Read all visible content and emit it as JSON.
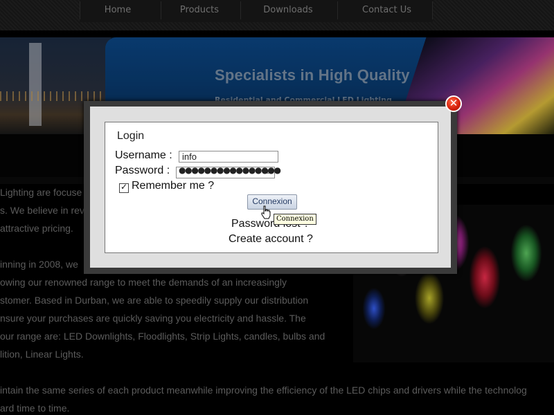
{
  "nav": {
    "items": [
      "Home",
      "Products",
      "Downloads",
      "Contact Us"
    ]
  },
  "banner": {
    "title": "Specialists in High Quality",
    "subtitle": "Residential and Commercial LED Lighting"
  },
  "body_text": [
    "Lighting are focuse",
    "s. We believe in rev",
    "attractive pricing.",
    "inning in 2008, we",
    "owing our renowned range to meet the demands of an increasingly",
    "stomer. Based in Durban, we are able to speedily supply our distribution",
    "nsure your purchases are quickly saving you electricity and hassle. The",
    "our range are: LED Downlights, Floodlights, Strip Lights, candles, bulbs and",
    "lition, Linear Lights.",
    "intain the same series of each product meanwhile improving the efficiency of the LED chips and drivers while the technolog",
    "ard time to time."
  ],
  "login": {
    "legend": "Login",
    "username_label": "Username :",
    "username_value": "info",
    "password_label": "Password :",
    "password_dots": "●●●●●●●●●●●●●●●●",
    "remember_label": "Remember me ?",
    "remember_checked": true,
    "submit_label": "Connexion",
    "password_lost": "Password lost ?",
    "create_account": "Create account ?"
  },
  "tooltip": {
    "text": "Connexion"
  },
  "icons": {
    "close": "close-icon",
    "checkbox": "checkmark-icon",
    "eye": "password-reveal-icon",
    "cursor": "hand-cursor-icon"
  },
  "colors": {
    "close_button": "#d8230c",
    "dialog_frame": "#3a3a3a",
    "banner_blue": "#0c4a8c",
    "tooltip_bg": "#ffffe1"
  }
}
